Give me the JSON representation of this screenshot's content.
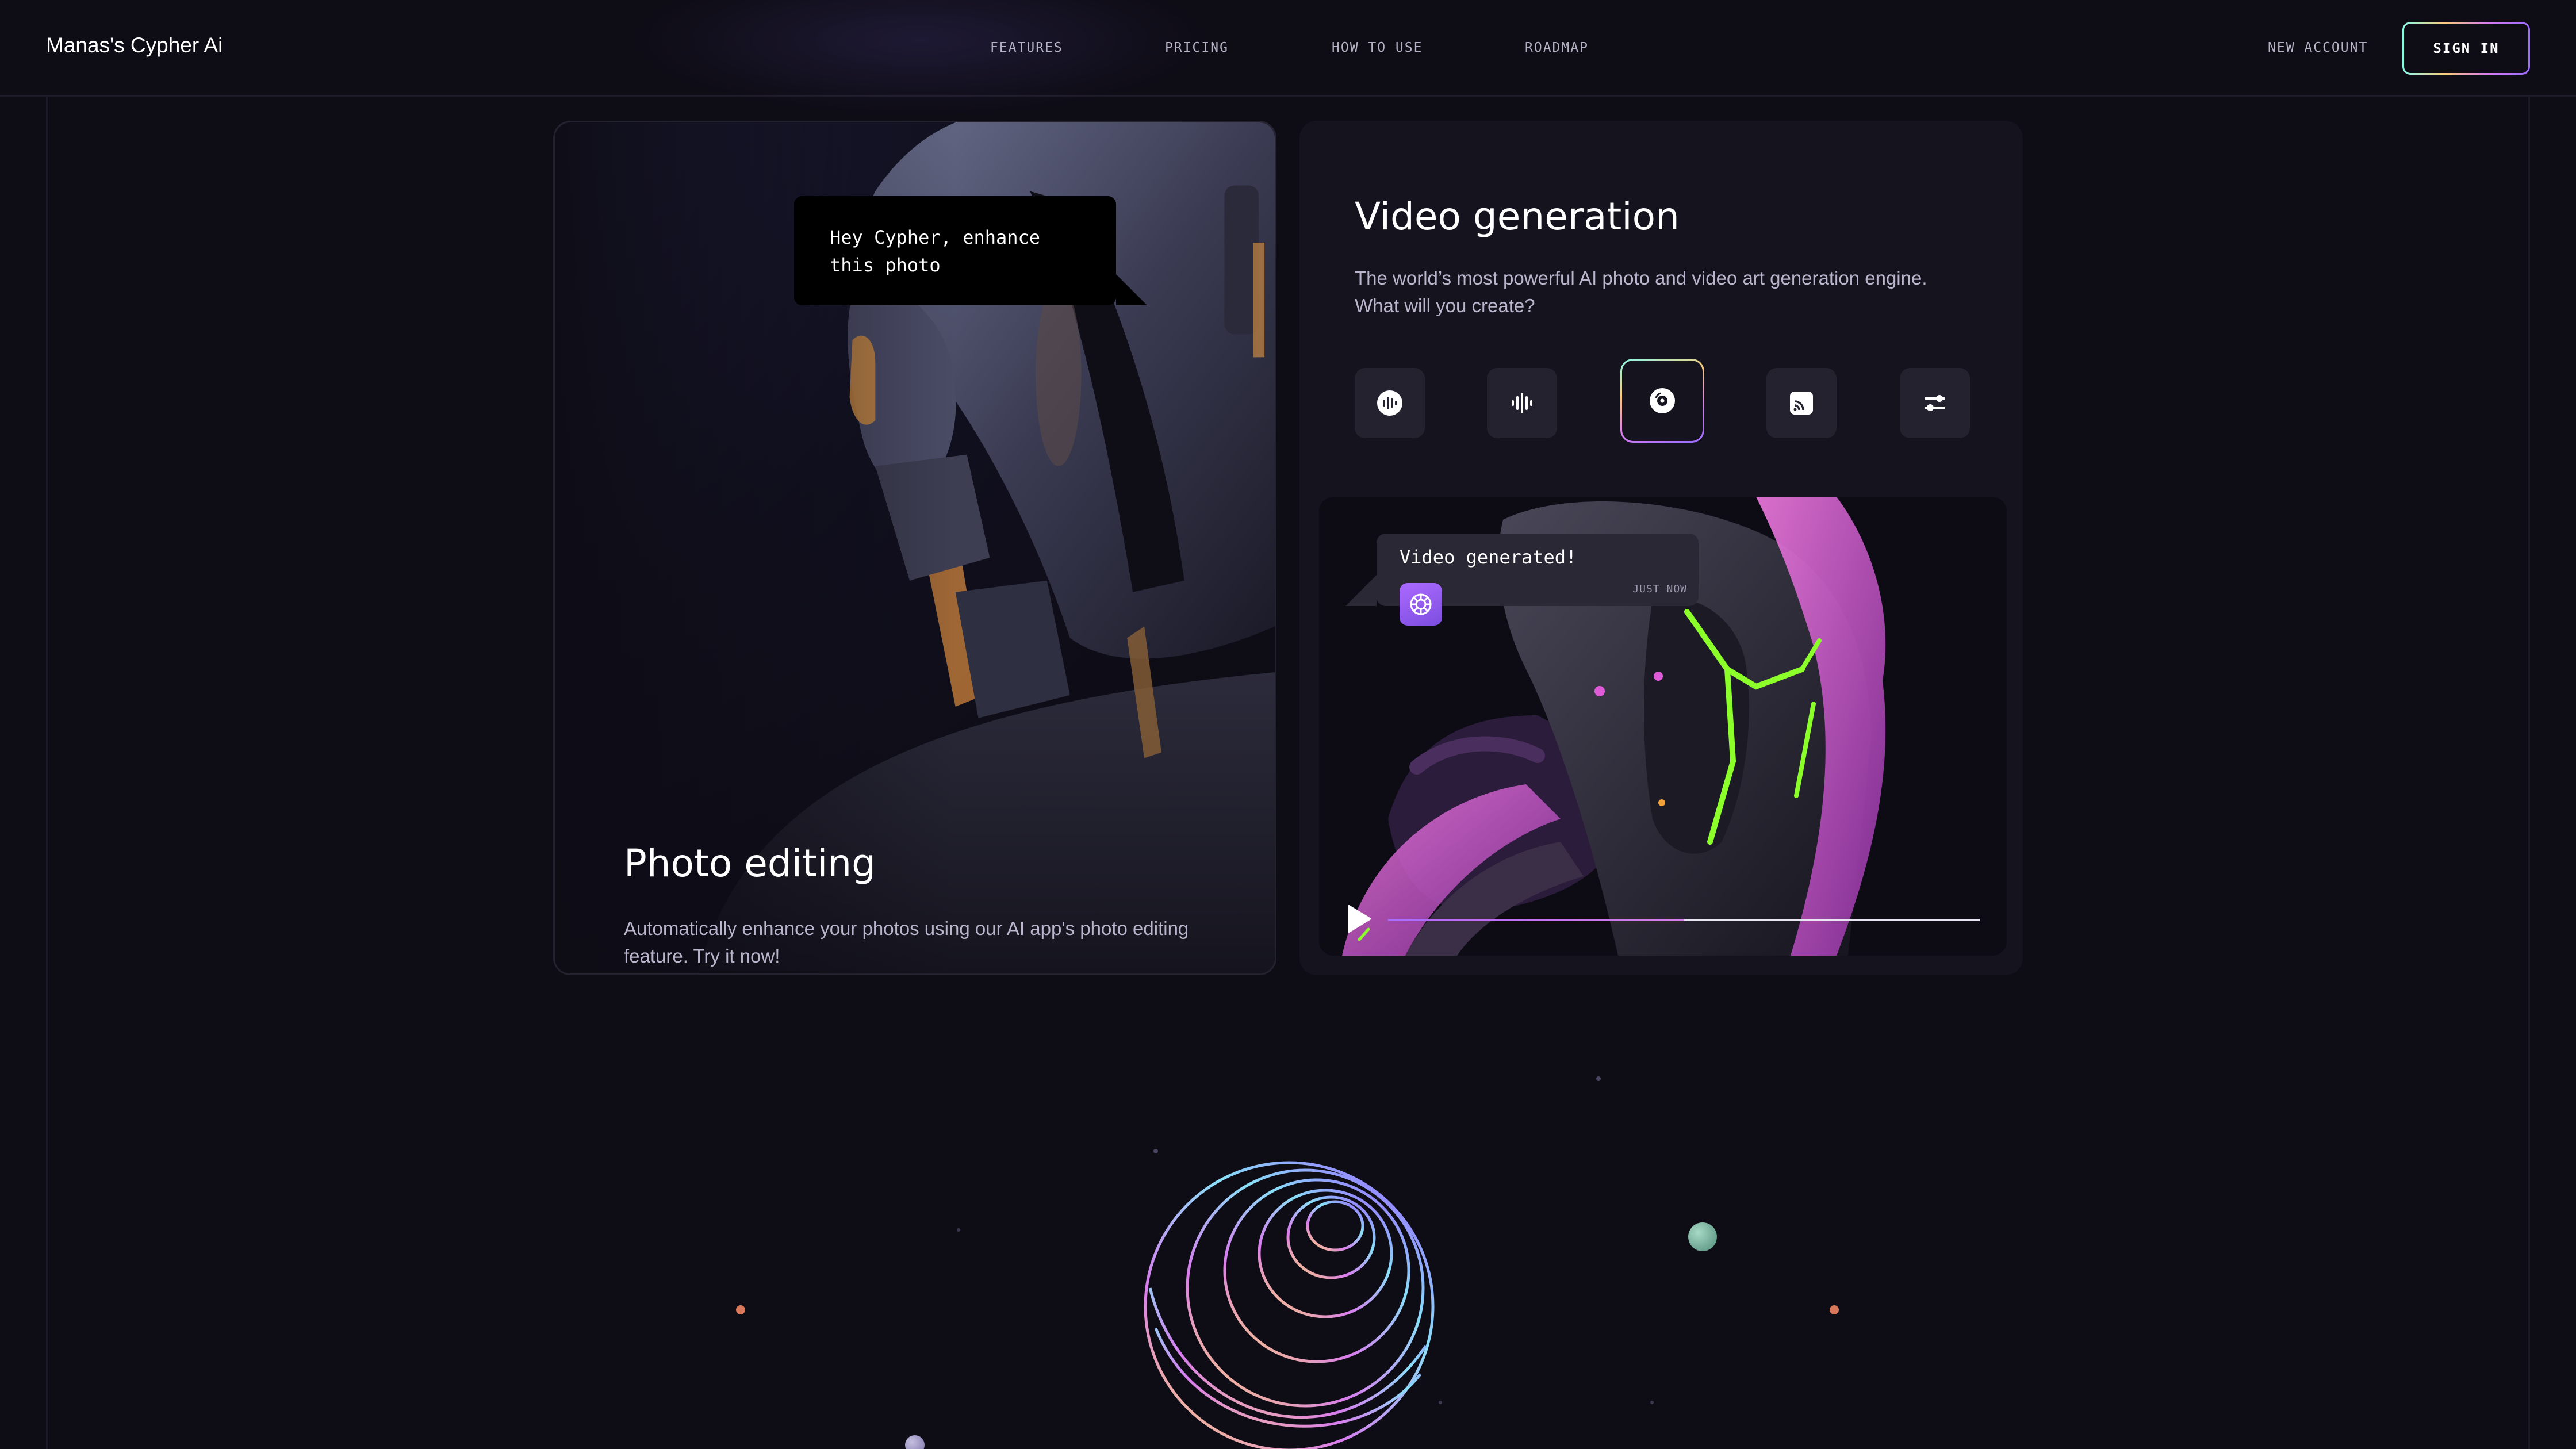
{
  "header": {
    "logo": "Manas's Cypher Ai",
    "nav": [
      "FEATURES",
      "PRICING",
      "HOW TO USE",
      "ROADMAP"
    ],
    "new_account": "NEW ACCOUNT",
    "sign_in": "SIGN IN"
  },
  "photo_card": {
    "bubble": "Hey Cypher, enhance this photo",
    "title": "Photo editing",
    "description": "Automatically enhance your photos using our AI app's photo editing feature. Try it now!"
  },
  "video_card": {
    "title": "Video generation",
    "description": "The world’s most powerful AI photo and video art generation engine. What will you create?",
    "tools": [
      {
        "icon": "voice-record-icon",
        "active": false
      },
      {
        "icon": "audio-wave-icon",
        "active": false
      },
      {
        "icon": "disc-icon",
        "active": true
      },
      {
        "icon": "cast-icon",
        "active": false
      },
      {
        "icon": "sliders-icon",
        "active": false
      }
    ],
    "bubble_text": "Video generated!",
    "bubble_time": "JUST NOW",
    "progress": 0.5
  },
  "colors": {
    "background": "#0e0c15",
    "card": "#15131d",
    "accent_purple": "#ac6aff",
    "neon_green": "#8cff2a",
    "neon_pink": "#e05bd8"
  }
}
